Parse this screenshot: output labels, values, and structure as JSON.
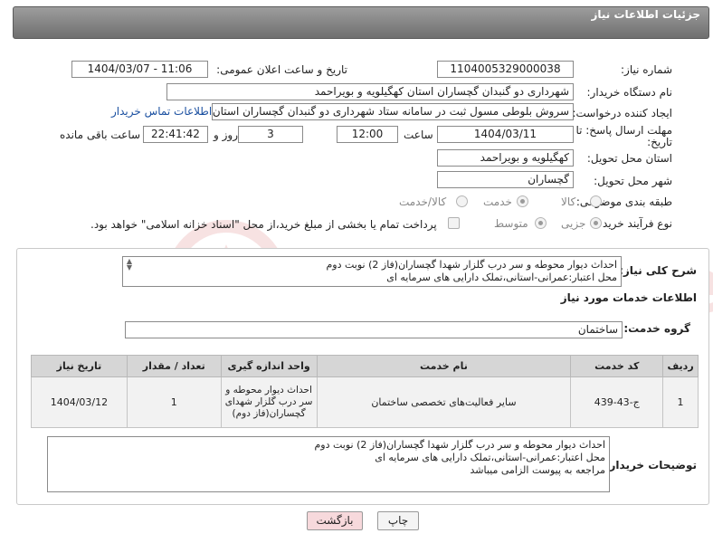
{
  "header": {
    "title": "جزئیات اطلاعات نیاز"
  },
  "form": {
    "need_number_label": "شماره نیاز:",
    "need_number": "1104005329000038",
    "announce_label": "تاریخ و ساعت اعلان عمومی:",
    "announce_value": "1404/03/07 - 11:06",
    "buyer_org_label": "نام دستگاه خریدار:",
    "buyer_org": "شهرداری دو گنبدان گچساران استان کهگیلویه و بویراحمد",
    "creator_label": "ایجاد کننده درخواست:",
    "creator": "سروش بلوطی مسول ثبت در سامانه ستاد شهرداری دو گنبدان گچساران استان",
    "contact_link": "اطلاعات تماس خریدار",
    "deadline_label": "مهلت ارسال پاسخ: تا تاریخ:",
    "deadline_date": "1404/03/11",
    "time_label": "ساعت",
    "deadline_time": "12:00",
    "days_value": "3",
    "days_label": "روز و",
    "remaining_time": "22:41:42",
    "remaining_label": "ساعت باقی مانده",
    "province_label": "استان محل تحویل:",
    "province": "کهگیلویه و بویراحمد",
    "city_label": "شهر محل تحویل:",
    "city": "گچساران",
    "category_label": "طبقه بندی موضوعی:",
    "category_options": [
      "کالا",
      "خدمت",
      "کالا/خدمت"
    ],
    "category_selected": "خدمت",
    "process_label": "نوع فرآیند خرید :",
    "process_options": [
      "جزیی",
      "متوسط"
    ],
    "process_selected": "جزیی",
    "payment_note": "پرداخت تمام یا بخشی از مبلغ خرید،از محل \"اسناد خزانه اسلامی\" خواهد بود."
  },
  "summary": {
    "label": "شرح کلی نیاز:",
    "text": "احداث دیوار محوطه و سر درب گلزار شهدا گچساران(فاز 2) نوبت دوم\nمحل اعتبار:عمرانی-استانی،تملک دارایی های سرمایه ای"
  },
  "services": {
    "section_title": "اطلاعات خدمات مورد نیاز",
    "group_label": "گروه خدمت:",
    "group_value": "ساختمان",
    "columns": [
      "ردیف",
      "کد خدمت",
      "نام خدمت",
      "واحد اندازه گیری",
      "تعداد / مقدار",
      "تاریخ نیاز"
    ],
    "rows": [
      [
        "1",
        "ج-43-439",
        "سایر فعالیت‌های تخصصی ساختمان",
        "احداث دیوار محوطه و سر درب گلزار شهدای گچساران(فاز دوم)",
        "1",
        "1404/03/12"
      ]
    ]
  },
  "buyer_notes": {
    "label": "توضیحات خریدار:",
    "text": "احداث دیوار محوطه و سر درب گلزار شهدا گچساران(فاز 2) نوبت دوم\nمحل اعتبار:عمرانی-استانی،تملک دارایی های سرمایه ای\nمراجعه به پیوست الزامی میباشد"
  },
  "buttons": {
    "print": "چاپ",
    "back": "بازگشت"
  },
  "watermark_text": "AriaTender.neT",
  "colors": {
    "header": "#8a8a8a",
    "link": "#1a4fa0",
    "back_button": "#f7d9dc",
    "watermark": "#c62828"
  }
}
